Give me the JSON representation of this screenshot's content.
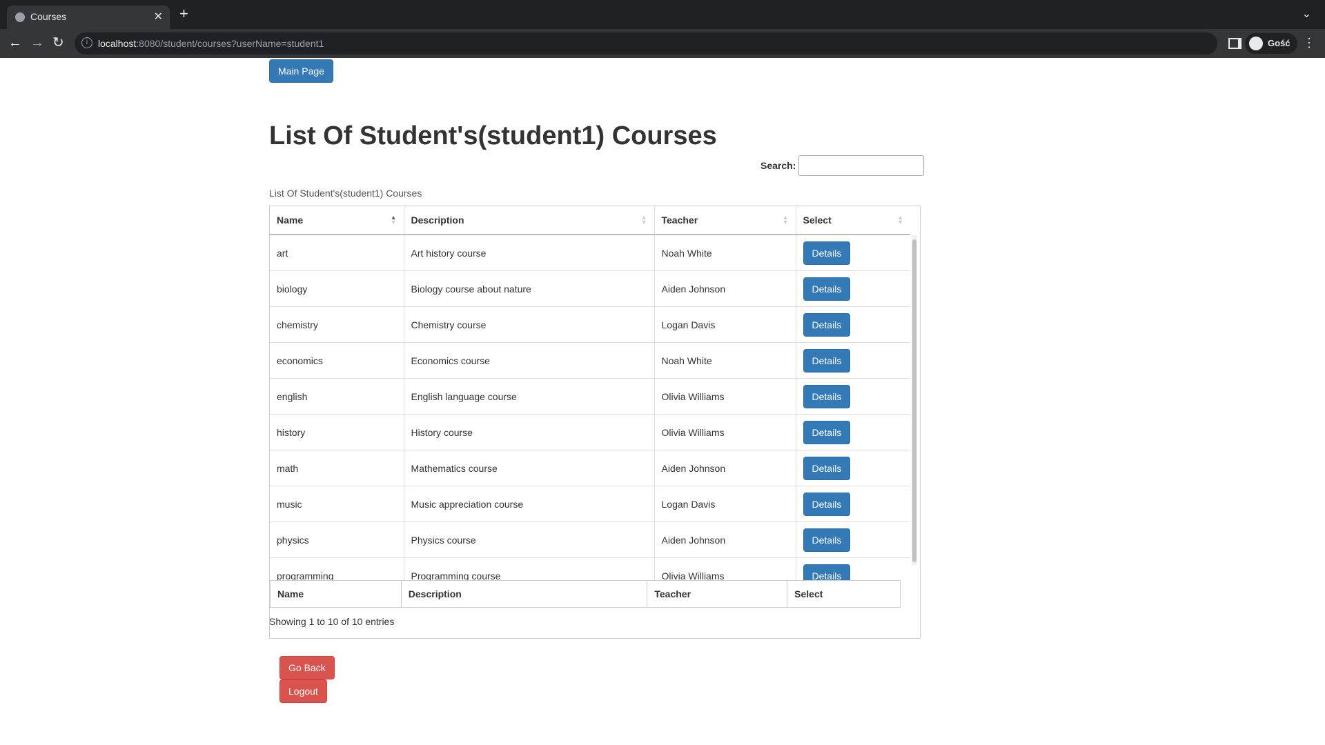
{
  "browser": {
    "tab_title": "Courses",
    "url_host": "localhost",
    "url_rest": ":8080/student/courses?userName=student1",
    "profile_name": "Gość"
  },
  "page": {
    "main_page_label": "Main Page",
    "title": "List Of Student's(student1) Courses",
    "search_label": "Search:",
    "search_value": "",
    "caption": "List Of Student's(student1) Courses",
    "info": "Showing 1 to 10 of 10 entries",
    "go_back_label": "Go Back",
    "logout_label": "Logout"
  },
  "table": {
    "columns": [
      "Name",
      "Description",
      "Teacher",
      "Select"
    ],
    "rows": [
      {
        "name": "art",
        "description": "Art history course",
        "teacher": "Noah White",
        "action": "Details"
      },
      {
        "name": "biology",
        "description": "Biology course about nature",
        "teacher": "Aiden Johnson",
        "action": "Details"
      },
      {
        "name": "chemistry",
        "description": "Chemistry course",
        "teacher": "Logan Davis",
        "action": "Details"
      },
      {
        "name": "economics",
        "description": "Economics course",
        "teacher": "Noah White",
        "action": "Details"
      },
      {
        "name": "english",
        "description": "English language course",
        "teacher": "Olivia Williams",
        "action": "Details"
      },
      {
        "name": "history",
        "description": "History course",
        "teacher": "Olivia Williams",
        "action": "Details"
      },
      {
        "name": "math",
        "description": "Mathematics course",
        "teacher": "Aiden Johnson",
        "action": "Details"
      },
      {
        "name": "music",
        "description": "Music appreciation course",
        "teacher": "Logan Davis",
        "action": "Details"
      },
      {
        "name": "physics",
        "description": "Physics course",
        "teacher": "Aiden Johnson",
        "action": "Details"
      },
      {
        "name": "programming",
        "description": "Programming course",
        "teacher": "Olivia Williams",
        "action": "Details"
      }
    ]
  },
  "colors": {
    "primary": "#337ab7",
    "danger": "#d9534f"
  }
}
